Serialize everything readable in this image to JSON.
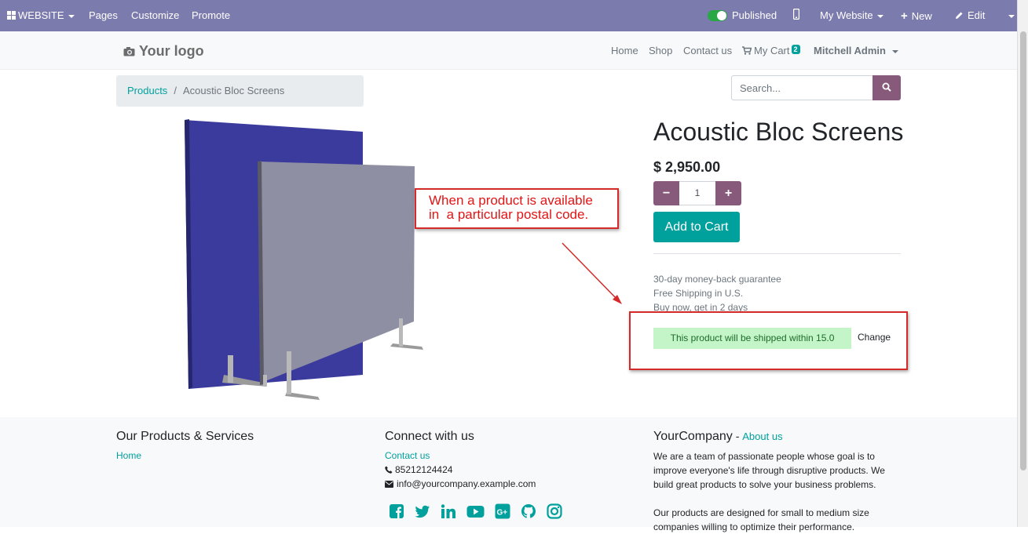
{
  "adminbar": {
    "website_label": "WEBSITE",
    "pages": "Pages",
    "customize": "Customize",
    "promote": "Promote",
    "published": "Published",
    "my_website": "My Website",
    "new": "New",
    "edit": "Edit"
  },
  "header": {
    "logo": "Your logo",
    "nav": [
      "Home",
      "Shop",
      "Contact us"
    ],
    "cart_label": "My Cart",
    "cart_count": "2",
    "user": "Mitchell Admin"
  },
  "breadcrumb": {
    "parent": "Products",
    "separator": "/",
    "current": "Acoustic Bloc Screens"
  },
  "search": {
    "placeholder": "Search..."
  },
  "product": {
    "title": "Acoustic Bloc Screens",
    "price": "$ 2,950.00",
    "quantity": "1",
    "add_to_cart": "Add to Cart",
    "guarantees": [
      "30-day money-back guarantee",
      "Free Shipping in U.S.",
      "Buy now, get in 2 days"
    ],
    "shipping_message": "This product will be shipped within 15.0",
    "change": "Change"
  },
  "annotation": {
    "text": "When a product is available\nin  a particular postal code."
  },
  "footer": {
    "col1_title": "Our Products & Services",
    "col1_link": "Home",
    "col2_title": "Connect with us",
    "col2_link": "Contact us",
    "phone": "85212124424",
    "email": "info@yourcompany.example.com",
    "col3_title": "YourCompany",
    "col3_dash": " - ",
    "col3_link": "About us",
    "about_p1": "We are a team of passionate people whose goal is to improve everyone's life through disruptive products. We build great products to solve your business problems.",
    "about_p2": "Our products are designed for small to medium size companies willing to optimize their performance.",
    "social_icons": [
      "facebook-icon",
      "twitter-icon",
      "linkedin-icon",
      "youtube-icon",
      "google-plus-icon",
      "github-icon",
      "instagram-icon"
    ]
  },
  "colors": {
    "adminbar": "#7c7bad",
    "primary": "#00a09d",
    "secondary": "#875a7b",
    "annotation": "#d42a2a",
    "shipping_bg": "#c3f5c8"
  }
}
